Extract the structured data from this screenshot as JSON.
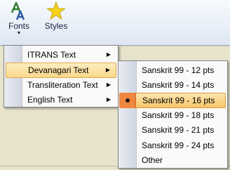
{
  "ribbon": {
    "fonts_label": "Fonts",
    "styles_label": "Styles",
    "dropdown_glyph": "▼"
  },
  "menu_script": {
    "items": [
      {
        "label": "ITRANS Text",
        "has_submenu": true
      },
      {
        "label": "Devanagari Text",
        "has_submenu": true,
        "highlighted": true
      },
      {
        "label": "Transliteration Text",
        "has_submenu": true
      },
      {
        "label": "English Text",
        "has_submenu": true
      }
    ],
    "submenu_arrow": "▶"
  },
  "menu_size": {
    "items": [
      {
        "label": "Sanskrit 99 - 12 pts"
      },
      {
        "label": "Sanskrit 99 - 14 pts"
      },
      {
        "label": "Sanskrit 99 - 16 pts",
        "checked": true
      },
      {
        "label": "Sanskrit 99 - 18 pts"
      },
      {
        "label": "Sanskrit 99 - 21 pts"
      },
      {
        "label": "Sanskrit 99 - 24 pts"
      },
      {
        "label": "Other"
      }
    ]
  },
  "colors": {
    "highlight": "#f9d98a",
    "checked_marker": "#f0873e",
    "fonts_icon_a": "#2a7a2a",
    "fonts_icon_b": "#2a5aa8",
    "styles_star": "#f5d31c"
  },
  "icons": {
    "fonts": "font-aa-icon",
    "styles": "star-icon"
  }
}
